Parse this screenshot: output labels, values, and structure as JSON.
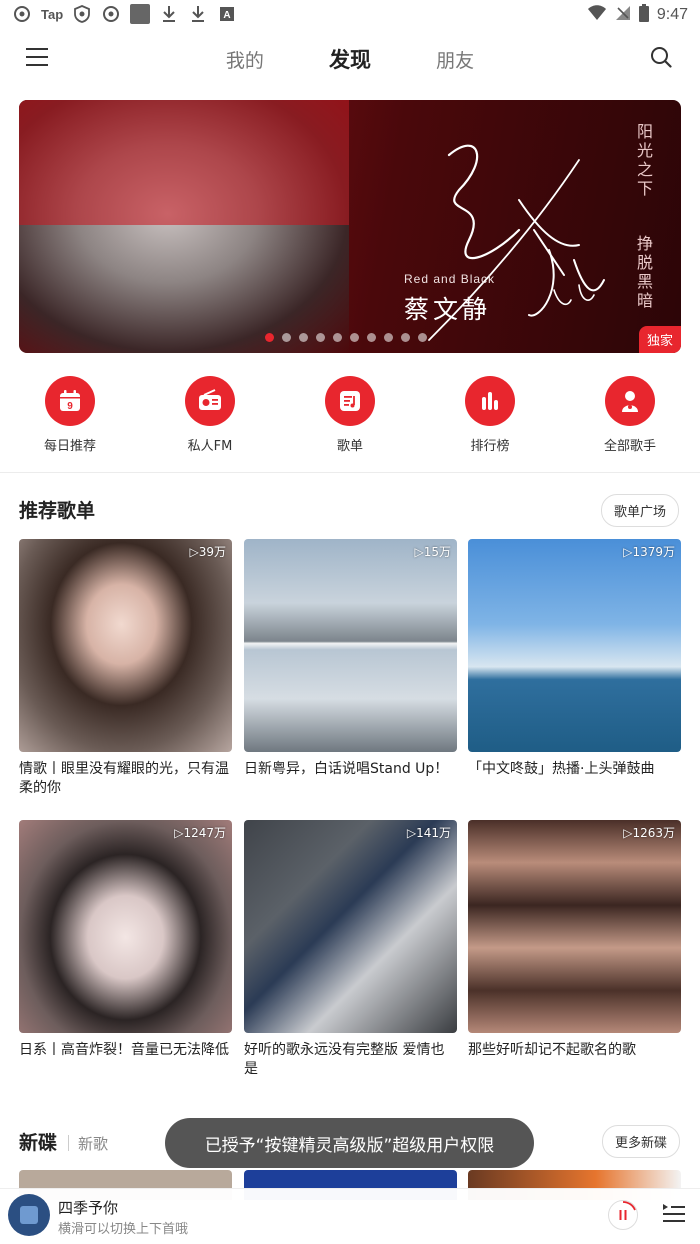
{
  "status_bar": {
    "time": "9:47",
    "left_icons": [
      "netease-music-icon",
      "tap-label",
      "shield-icon",
      "netease-music-icon",
      "square-icon",
      "download-icon",
      "download-icon",
      "a-icon"
    ],
    "tap_label": "Tap",
    "right_icons": [
      "wifi-icon",
      "signal-icon",
      "battery-icon"
    ]
  },
  "header": {
    "tabs": [
      {
        "label": "我的",
        "active": false
      },
      {
        "label": "发现",
        "active": true
      },
      {
        "label": "朋友",
        "active": false
      }
    ]
  },
  "banner": {
    "subtitle": "Red and Black",
    "artist": "蔡文静",
    "vertical_text_top": "阳光之下",
    "vertical_text_bottom": "挣脱黑暗",
    "badge": "独家",
    "dot_count": 10,
    "active_dot": 0
  },
  "quick_entries": [
    {
      "label": "每日推荐",
      "icon": "calendar-icon",
      "day": "9"
    },
    {
      "label": "私人FM",
      "icon": "radio-icon"
    },
    {
      "label": "歌单",
      "icon": "playlist-icon"
    },
    {
      "label": "排行榜",
      "icon": "chart-icon"
    },
    {
      "label": "全部歌手",
      "icon": "singer-icon"
    }
  ],
  "recommended": {
    "title": "推荐歌单",
    "more_button": "歌单广场",
    "playlists": [
      {
        "plays": "▷39万",
        "title": "情歌丨眼里没有耀眼的光，只有温柔的你"
      },
      {
        "plays": "▷15万",
        "title": "日新粤异，白话说唱Stand Up！"
      },
      {
        "plays": "▷1379万",
        "title": "「中文咚鼓」热播·上头弹鼓曲"
      },
      {
        "plays": "▷1247万",
        "title": "日系丨高音炸裂！音量已无法降低"
      },
      {
        "plays": "▷141万",
        "title": "好听的歌永远没有完整版 爱情也是"
      },
      {
        "plays": "▷1263万",
        "title": "那些好听却记不起歌名的歌"
      }
    ]
  },
  "new_albums": {
    "title": "新碟",
    "subtitle": "新歌",
    "more_button": "更多新碟"
  },
  "toast": {
    "text": "已授予“按键精灵高级版”超级用户权限"
  },
  "player": {
    "title": "四季予你",
    "hint": "横滑可以切换上下首哦"
  },
  "colors": {
    "accent": "#e8262e",
    "text_primary": "#222222",
    "text_secondary": "#888888"
  }
}
